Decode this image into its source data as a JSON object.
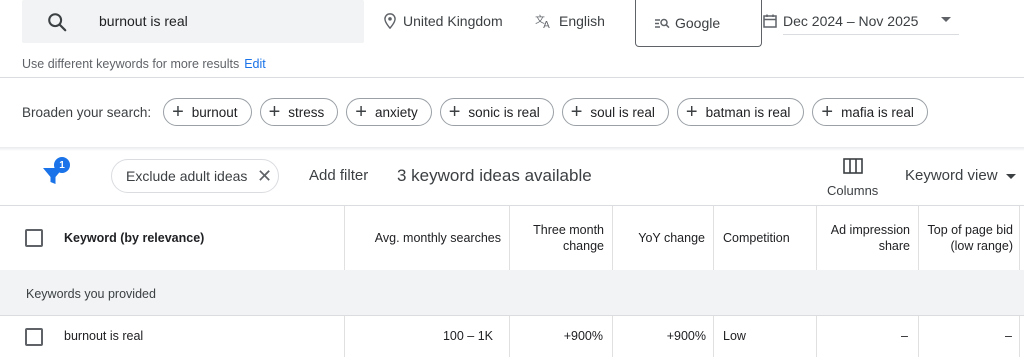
{
  "search": {
    "value": "burnout is real",
    "icon": "search-icon",
    "location": "United Kingdom",
    "language": "English",
    "engine": "Google",
    "date_range": "Dec 2024 – Nov 2025"
  },
  "hint": {
    "text": "Use different keywords for more results",
    "edit": "Edit"
  },
  "broaden": {
    "label": "Broaden your search:",
    "chips": [
      "burnout",
      "stress",
      "anxiety",
      "sonic is real",
      "soul is real",
      "batman is real",
      "mafia is real"
    ]
  },
  "filters": {
    "badge": "1",
    "exclude_chip": "Exclude adult ideas",
    "add_filter": "Add filter",
    "ideas_count": "3 keyword ideas available",
    "columns": "Columns",
    "view": "Keyword view"
  },
  "table": {
    "headers": {
      "keyword": "Keyword (by relevance)",
      "avg": "Avg. monthly searches",
      "three_month": "Three month change",
      "yoy": "YoY change",
      "competition": "Competition",
      "ad_share": "Ad impression share",
      "top_bid": "Top of page bid (low range)"
    },
    "group_label": "Keywords you provided",
    "rows": [
      {
        "keyword": "burnout is real",
        "avg": "100 – 1K",
        "three_month": "+900%",
        "yoy": "+900%",
        "competition": "Low",
        "ad_share": "–",
        "top_bid": "–"
      }
    ]
  },
  "colors": {
    "accent": "#1a73e8",
    "search_bg": "#f1f3f4",
    "group_bg": "#f1f3f4"
  }
}
